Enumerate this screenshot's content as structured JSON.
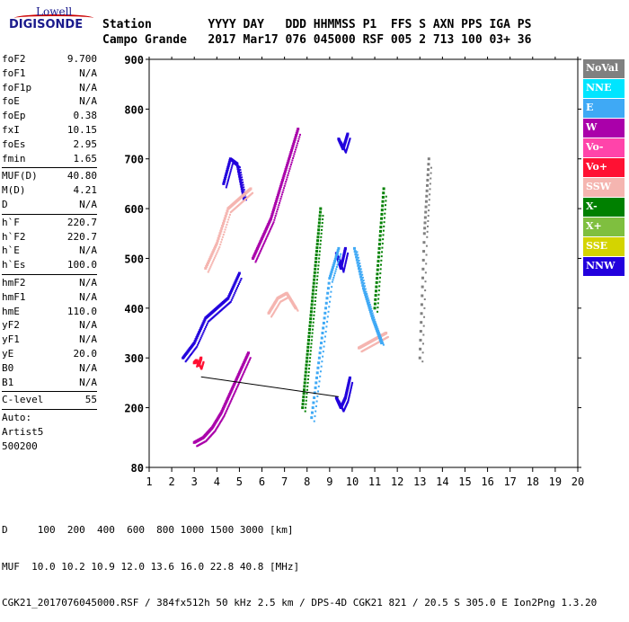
{
  "logo": {
    "line1": "Lowell",
    "line2": "DIGISONDE"
  },
  "header": {
    "line1": "Station        YYYY DAY   DDD HHMMSS P1  FFS S AXN PPS IGA PS",
    "line2": "Campo Grande   2017 Mar17 076 045000 RSF 005 2 713 100 03+ 36"
  },
  "params": [
    {
      "group": [
        {
          "name": "foF2",
          "value": "9.700"
        },
        {
          "name": "foF1",
          "value": "N/A"
        },
        {
          "name": "foF1p",
          "value": "N/A"
        },
        {
          "name": "foE",
          "value": "N/A"
        },
        {
          "name": "foEp",
          "value": "0.38"
        },
        {
          "name": "fxI",
          "value": "10.15"
        },
        {
          "name": "foEs",
          "value": "2.95"
        },
        {
          "name": "fmin",
          "value": "1.65"
        }
      ]
    },
    {
      "group": [
        {
          "name": "MUF(D)",
          "value": "40.80"
        },
        {
          "name": "M(D)",
          "value": "4.21"
        },
        {
          "name": "D",
          "value": "N/A"
        }
      ]
    },
    {
      "group": [
        {
          "name": "h`F",
          "value": "220.7"
        },
        {
          "name": "h`F2",
          "value": "220.7"
        },
        {
          "name": "h`E",
          "value": "N/A"
        },
        {
          "name": "h`Es",
          "value": "100.0"
        }
      ]
    },
    {
      "group": [
        {
          "name": "hmF2",
          "value": "N/A"
        },
        {
          "name": "hmF1",
          "value": "N/A"
        },
        {
          "name": "hmE",
          "value": "110.0"
        },
        {
          "name": "yF2",
          "value": "N/A"
        },
        {
          "name": "yF1",
          "value": "N/A"
        },
        {
          "name": "yE",
          "value": "20.0"
        },
        {
          "name": "B0",
          "value": "N/A"
        },
        {
          "name": "B1",
          "value": "N/A"
        }
      ]
    },
    {
      "group": [
        {
          "name": "C-level",
          "value": "55"
        }
      ]
    }
  ],
  "autoscale": {
    "line1": "Auto:",
    "line2": "Artist5",
    "line3": "500200"
  },
  "legend": [
    {
      "label": "NoVal",
      "color": "#808080"
    },
    {
      "label": "NNE",
      "color": "#00e5ff"
    },
    {
      "label": "E",
      "color": "#3fa9f5"
    },
    {
      "label": "W",
      "color": "#aa00aa"
    },
    {
      "label": "Vo-",
      "color": "#ff44aa"
    },
    {
      "label": "Vo+",
      "color": "#ff1133"
    },
    {
      "label": "SSW",
      "color": "#f5b5b0"
    },
    {
      "label": "X-",
      "color": "#008000"
    },
    {
      "label": "X+",
      "color": "#7fbf3f"
    },
    {
      "label": "SSE",
      "color": "#d4d400"
    },
    {
      "label": "NNW",
      "color": "#2200dd"
    }
  ],
  "footer": {
    "line1": "D     100  200  400  600  800 1000 1500 3000 [km]",
    "line2": "MUF  10.0 10.2 10.9 12.0 13.6 16.0 22.8 40.8 [MHz]",
    "line3": "CGK21_2017076045000.RSF / 384fx512h 50 kHz 2.5 km / DPS-4D CGK21 821 / 20.5 S 305.0 E Ion2Png 1.3.20"
  },
  "chart_data": {
    "type": "scatter",
    "title": "",
    "xlabel": "",
    "ylabel": "",
    "xlim": [
      1,
      20
    ],
    "ylim": [
      80,
      900
    ],
    "xticks": [
      "1",
      "2",
      "3",
      "4",
      "5",
      "6",
      "7",
      "8",
      "9",
      "10",
      "11",
      "12",
      "13",
      "14",
      "15",
      "16",
      "17",
      "18",
      "19",
      "20"
    ],
    "yticks": [
      "80",
      "200",
      "300",
      "400",
      "500",
      "600",
      "700",
      "800",
      "900"
    ],
    "trace_line": {
      "x": [
        3.3,
        9.4
      ],
      "y": [
        262,
        222
      ]
    },
    "series": [
      {
        "name": "W",
        "traces": [
          {
            "x": [
              3.0,
              3.4,
              3.8,
              4.2,
              4.6,
              5.0,
              5.4
            ],
            "y": [
              130,
              140,
              160,
              190,
              230,
              270,
              310
            ]
          },
          {
            "x": [
              5.6,
              6.0,
              6.4,
              6.8,
              7.2,
              7.6
            ],
            "y": [
              500,
              540,
              580,
              640,
              700,
              760
            ]
          }
        ]
      },
      {
        "name": "NNW",
        "traces": [
          {
            "x": [
              2.5,
              3.0,
              3.5,
              4.0,
              4.5,
              5.0
            ],
            "y": [
              300,
              330,
              380,
              400,
              420,
              470
            ]
          },
          {
            "x": [
              4.3,
              4.6,
              4.9,
              5.2
            ],
            "y": [
              650,
              700,
              690,
              620
            ]
          },
          {
            "x": [
              9.3,
              9.5,
              9.7,
              9.9
            ],
            "y": [
              220,
              200,
              220,
              260
            ]
          },
          {
            "x": [
              9.3,
              9.5,
              9.7
            ],
            "y": [
              510,
              480,
              520
            ]
          },
          {
            "x": [
              9.4,
              9.6,
              9.8
            ],
            "y": [
              740,
              720,
              750
            ]
          }
        ]
      },
      {
        "name": "SSW",
        "traces": [
          {
            "x": [
              3.5,
              4.0,
              4.5,
              5.0,
              5.5
            ],
            "y": [
              480,
              530,
              600,
              620,
              640
            ]
          },
          {
            "x": [
              6.3,
              6.7,
              7.1,
              7.5
            ],
            "y": [
              390,
              420,
              430,
              400
            ]
          },
          {
            "x": [
              10.3,
              10.7,
              11.1,
              11.5
            ],
            "y": [
              320,
              330,
              340,
              350
            ]
          }
        ]
      },
      {
        "name": "X-",
        "traces": [
          {
            "x": [
              7.8,
              8.0,
              8.2,
              8.4,
              8.6
            ],
            "y": [
              200,
              300,
              400,
              500,
              600
            ]
          },
          {
            "x": [
              11.0,
              11.2,
              11.4
            ],
            "y": [
              400,
              520,
              640
            ]
          }
        ]
      },
      {
        "name": "E",
        "traces": [
          {
            "x": [
              8.2,
              8.6,
              9.0,
              9.4
            ],
            "y": [
              180,
              320,
              460,
              520
            ]
          },
          {
            "x": [
              10.1,
              10.5,
              10.9,
              11.3
            ],
            "y": [
              520,
              440,
              380,
              330
            ]
          }
        ]
      },
      {
        "name": "Vo+",
        "traces": [
          {
            "x": [
              3.0,
              3.1,
              3.2,
              3.3
            ],
            "y": [
              290,
              295,
              285,
              300
            ]
          }
        ]
      },
      {
        "name": "NoVal",
        "traces": [
          {
            "x": [
              13.0,
              13.2,
              13.4
            ],
            "y": [
              300,
              550,
              700
            ]
          }
        ]
      }
    ]
  }
}
